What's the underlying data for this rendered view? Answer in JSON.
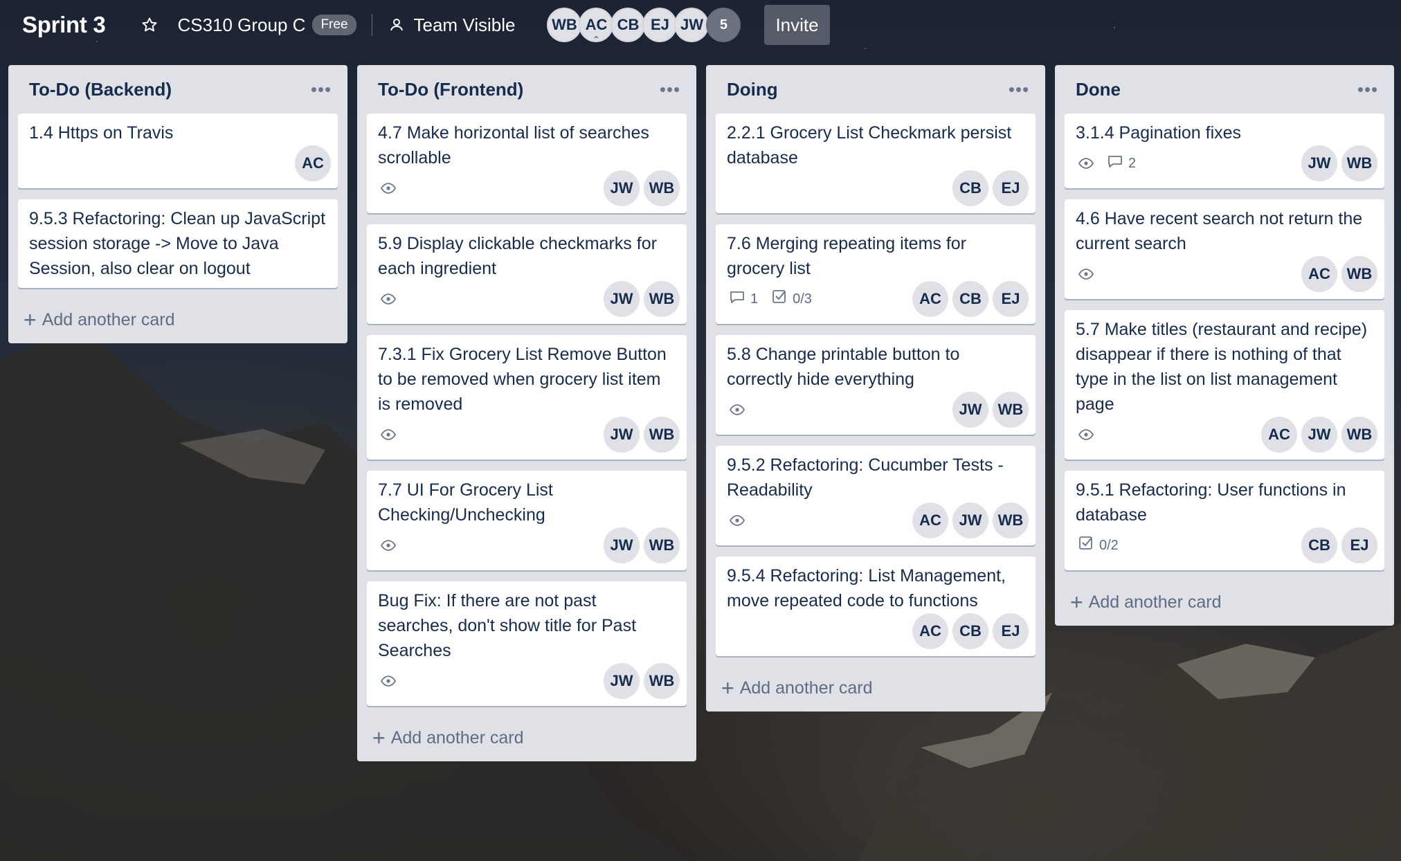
{
  "header": {
    "board_title": "Sprint 3",
    "team_name": "CS310 Group C",
    "team_plan": "Free",
    "visibility": "Team Visible",
    "members": [
      "WB",
      "AC",
      "CB",
      "EJ",
      "JW"
    ],
    "member_count": "5",
    "invite_label": "Invite"
  },
  "lists": [
    {
      "title": "To-Do (Backend)",
      "add_label": "Add another card",
      "cards": [
        {
          "title": "1.4 Https on Travis",
          "members": [
            "AC"
          ]
        },
        {
          "title": "9.5.3 Refactoring: Clean up JavaScript session storage -> Move to Java Session, also clear on logout",
          "members": []
        }
      ]
    },
    {
      "title": "To-Do (Frontend)",
      "add_label": "Add another card",
      "cards": [
        {
          "title": "4.7 Make horizontal list of searches scrollable",
          "members": [
            "JW",
            "WB"
          ]
        },
        {
          "title": "5.9 Display clickable checkmarks for each ingredient",
          "members": [
            "JW",
            "WB"
          ]
        },
        {
          "title": "7.3.1 Fix Grocery List Remove Button to be removed when grocery list item is removed",
          "members": [
            "JW",
            "WB"
          ]
        },
        {
          "title": "7.7 UI For Grocery List Checking/Unchecking",
          "members": [
            "JW",
            "WB"
          ]
        },
        {
          "title": "Bug Fix: If there are not past searches, don't show title for Past Searches",
          "members": [
            "JW",
            "WB"
          ]
        }
      ]
    },
    {
      "title": "Doing",
      "add_label": "Add another card",
      "cards": [
        {
          "title": "2.2.1 Grocery List Checkmark persist database",
          "members": [
            "CB",
            "EJ"
          ]
        },
        {
          "title": "7.6 Merging repeating items for grocery list",
          "comments": "1",
          "checklist": "0/3",
          "members": [
            "AC",
            "CB",
            "EJ"
          ]
        },
        {
          "title": "5.8 Change printable button to correctly hide everything",
          "members": [
            "JW",
            "WB"
          ]
        },
        {
          "title": "9.5.2 Refactoring: Cucumber Tests - Readability",
          "members": [
            "AC",
            "JW",
            "WB"
          ]
        },
        {
          "title": "9.5.4 Refactoring: List Management, move repeated code to functions",
          "members": [
            "AC",
            "CB",
            "EJ"
          ]
        }
      ]
    },
    {
      "title": "Done",
      "add_label": "Add another card",
      "cards": [
        {
          "title": "3.1.4 Pagination fixes",
          "comments": "2",
          "members": [
            "JW",
            "WB"
          ]
        },
        {
          "title": "4.6 Have recent search not return the current search",
          "members": [
            "AC",
            "WB"
          ]
        },
        {
          "title": "5.7 Make titles (restaurant and recipe) disappear if there is nothing of that type in the list on list management page",
          "members": [
            "AC",
            "JW",
            "WB"
          ]
        },
        {
          "title": "9.5.1 Refactoring: User functions in database",
          "checklist": "0/2",
          "members": [
            "CB",
            "EJ"
          ]
        }
      ]
    }
  ]
}
